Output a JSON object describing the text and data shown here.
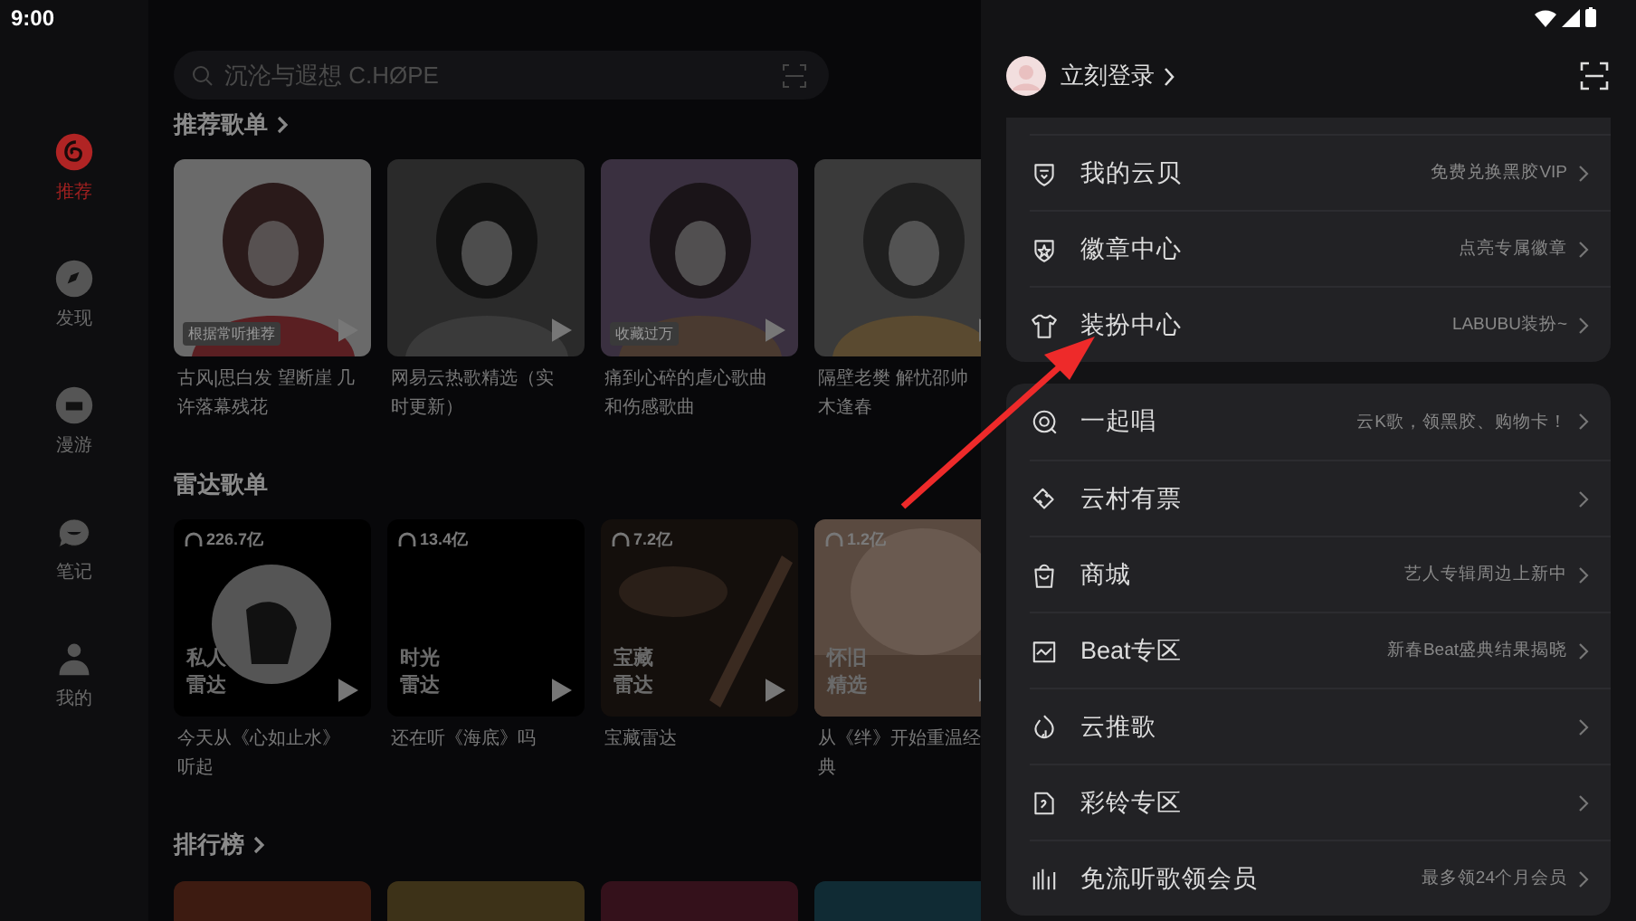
{
  "status_bar": {
    "time": "9:00"
  },
  "sidebar": {
    "items": [
      {
        "label": "推荐",
        "selected": true
      },
      {
        "label": "发现",
        "selected": false
      },
      {
        "label": "漫游",
        "selected": false
      },
      {
        "label": "笔记",
        "selected": false
      },
      {
        "label": "我的",
        "selected": false
      }
    ]
  },
  "search": {
    "placeholder": "沉沦与遐想 C.HØPE"
  },
  "recommended_playlists": {
    "title": "推荐歌单",
    "cards": [
      {
        "badge": "根据常听推荐",
        "title": "古风|思白发 望断崖 几许落幕残花"
      },
      {
        "title": "网易云热歌精选（实时更新）"
      },
      {
        "badge": "收藏过万",
        "title": "痛到心碎的虐心歌曲和伤感歌曲"
      },
      {
        "title": "隔壁老樊 解忧邵帅木逢春"
      }
    ]
  },
  "radar_playlists": {
    "title": "雷达歌单",
    "cards": [
      {
        "plays": "226.7亿",
        "cover_label": [
          "私人",
          "雷达"
        ],
        "title": "今天从《心如止水》听起"
      },
      {
        "plays": "13.4亿",
        "cover_label": [
          "时光",
          "雷达"
        ],
        "title": "还在听《海底》吗"
      },
      {
        "plays": "7.2亿",
        "cover_label": [
          "宝藏",
          "雷达"
        ],
        "title": "宝藏雷达"
      },
      {
        "plays": "1.2亿",
        "cover_label": [
          "怀旧",
          "精选"
        ],
        "title": "从《绊》开始重温经典"
      }
    ]
  },
  "charts": {
    "title": "排行榜"
  },
  "drawer": {
    "login": "立刻登录",
    "groups": [
      [
        {
          "label": "我的云贝",
          "hint": "免费兑换黑胶VIP"
        },
        {
          "label": "徽章中心",
          "hint": "点亮专属徽章"
        },
        {
          "label": "装扮中心",
          "hint": "LABUBU装扮~"
        }
      ],
      [
        {
          "label": "一起唱",
          "hint": "云K歌，领黑胶、购物卡！"
        },
        {
          "label": "云村有票"
        },
        {
          "label": "商城",
          "hint": "艺人专辑周边上新中"
        },
        {
          "label": "Beat专区",
          "hint": "新春Beat盛典结果揭晓"
        },
        {
          "label": "云推歌"
        },
        {
          "label": "彩铃专区"
        },
        {
          "label": "免流听歌领会员",
          "hint": "最多领24个月会员"
        }
      ]
    ]
  }
}
